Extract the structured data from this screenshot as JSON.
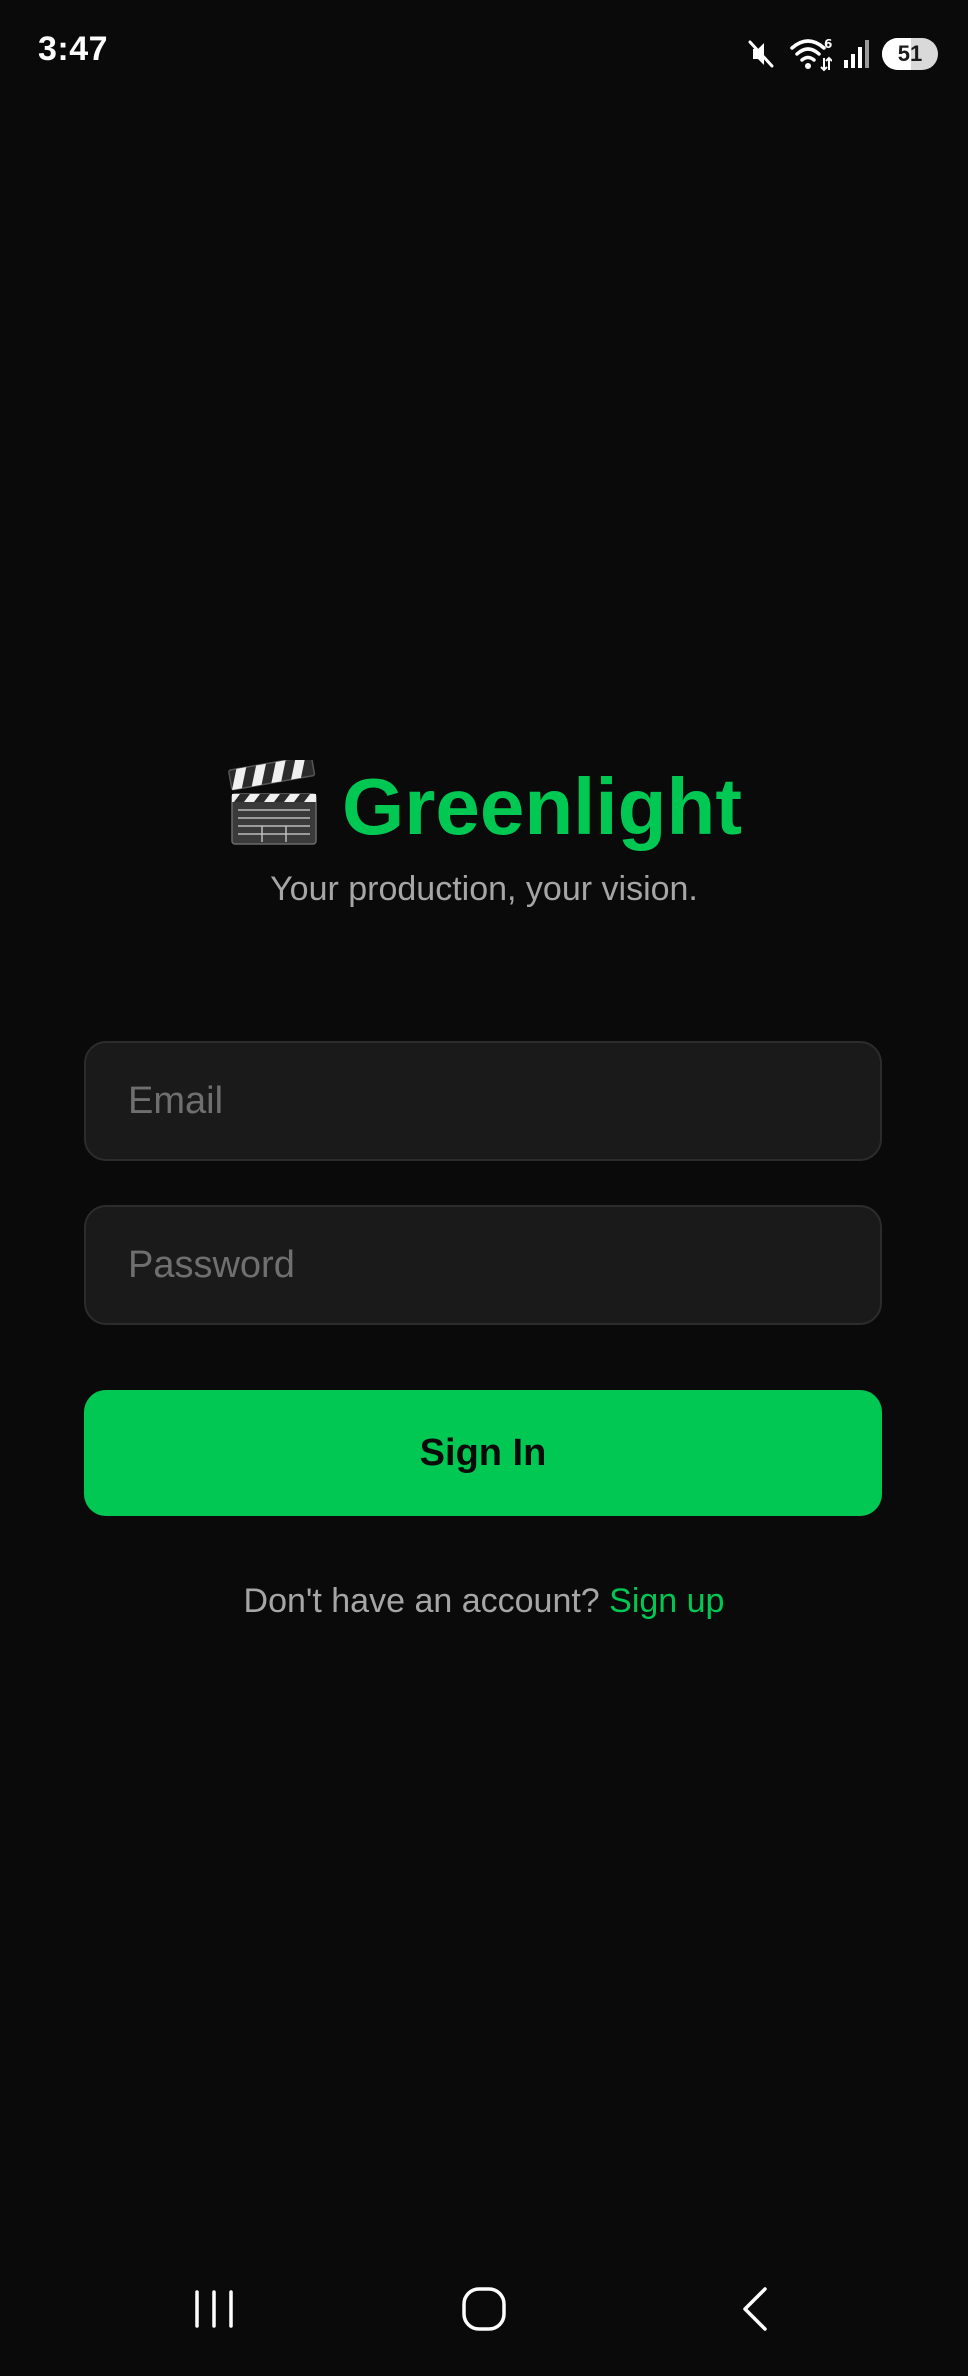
{
  "status_bar": {
    "time": "3:47",
    "battery_level": "51",
    "network_label": "6",
    "icons": [
      "mute-icon",
      "wifi-icon",
      "signal-icon",
      "battery-icon"
    ]
  },
  "brand": {
    "icon": "clapperboard-icon",
    "title": "Greenlight",
    "tagline": "Your production, your vision."
  },
  "form": {
    "email_placeholder": "Email",
    "email_value": "",
    "password_placeholder": "Password",
    "password_value": "",
    "signin_label": "Sign In"
  },
  "signup": {
    "prompt": "Don't have an account?",
    "link_label": "Sign up"
  },
  "nav_bar": {
    "icons": [
      "recents-icon",
      "home-icon",
      "back-icon"
    ]
  },
  "colors": {
    "background": "#0a0a0a",
    "accent": "#00c853",
    "field_bg": "#1a1a1a",
    "muted_text": "#a6a6a6"
  }
}
